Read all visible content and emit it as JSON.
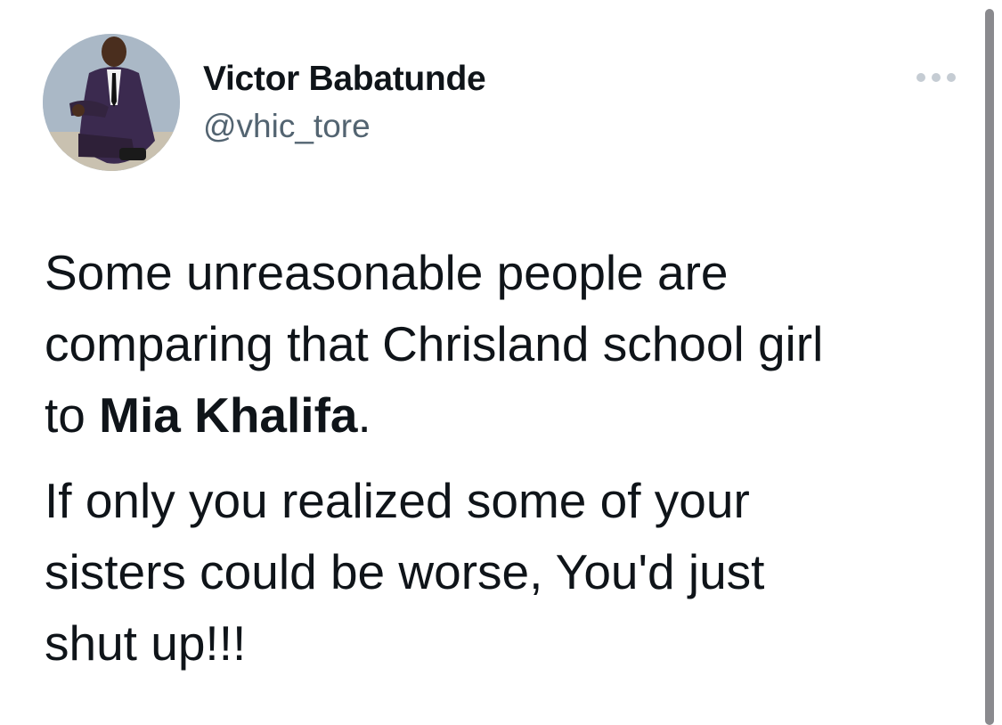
{
  "tweet": {
    "author": {
      "display_name": "Victor Babatunde",
      "handle": "@vhic_tore",
      "avatar_icon": "profile-photo-icon"
    },
    "more_icon": "more-dots-icon",
    "text": {
      "para1_line1": "Some unreasonable people are",
      "para1_line2": "comparing that Chrisland school girl",
      "para1_line3_prefix": "to ",
      "para1_line3_bold": "Mia Khalifa",
      "para1_line3_suffix": ".",
      "para2_line1": "If only you realized some of your",
      "para2_line2": "sisters could be worse, You'd just",
      "para2_line3": "shut up!!!"
    }
  },
  "colors": {
    "text": "#0f1419",
    "secondary_text": "#536471",
    "more_icon": "#8b98a5",
    "scrollbar": "#8a8a8e",
    "background": "#ffffff"
  }
}
